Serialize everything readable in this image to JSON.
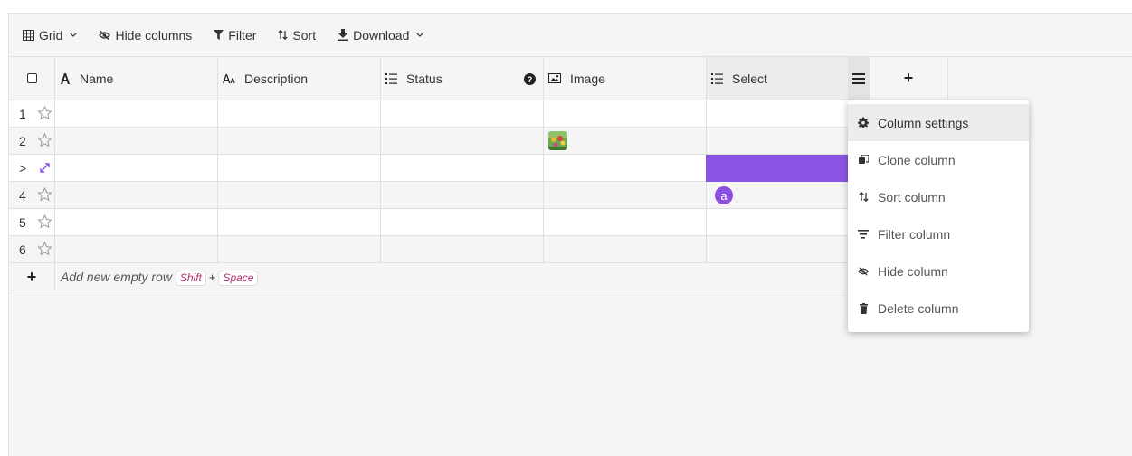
{
  "toolbar": {
    "grid_label": "Grid",
    "hide_columns_label": "Hide columns",
    "filter_label": "Filter",
    "sort_label": "Sort",
    "download_label": "Download"
  },
  "columns": [
    {
      "label": "Name",
      "icon": "text-icon"
    },
    {
      "label": "Description",
      "icon": "text-small-icon"
    },
    {
      "label": "Status",
      "icon": "list-icon"
    },
    {
      "label": "Image",
      "icon": "image-icon"
    },
    {
      "label": "Select",
      "icon": "list-icon"
    }
  ],
  "add_column_label": "+",
  "rows": [
    {
      "num": "1"
    },
    {
      "num": "2"
    },
    {
      "num": ">"
    },
    {
      "num": "4"
    },
    {
      "num": "5"
    },
    {
      "num": "6"
    }
  ],
  "row4_select_badge": "a",
  "add_row": {
    "text": "Add new empty row",
    "key1": "Shift",
    "plus": "+",
    "key2": "Space",
    "button": "+"
  },
  "menu": {
    "items": [
      {
        "label": "Column settings",
        "icon": "gear-icon"
      },
      {
        "label": "Clone column",
        "icon": "copy-icon"
      },
      {
        "label": "Sort column",
        "icon": "sort-icon"
      },
      {
        "label": "Filter column",
        "icon": "filter-icon"
      },
      {
        "label": "Hide column",
        "icon": "eye-off-icon"
      },
      {
        "label": "Delete column",
        "icon": "trash-icon"
      }
    ]
  },
  "colors": {
    "accent": "#8b55e3",
    "badge": "#8b4fe0",
    "kbd_text": "#b0306e"
  }
}
